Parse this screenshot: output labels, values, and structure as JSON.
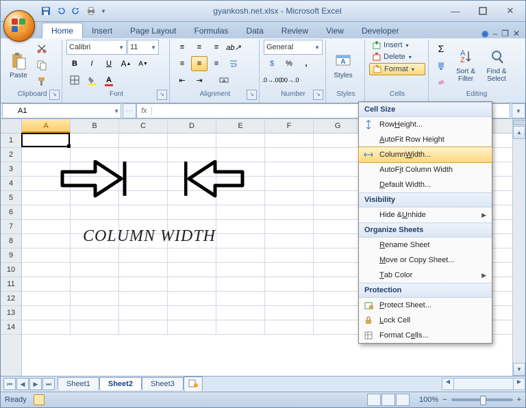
{
  "title": "gyankosh.net.xlsx - Microsoft Excel",
  "tabs": [
    "Home",
    "Insert",
    "Page Layout",
    "Formulas",
    "Data",
    "Review",
    "View",
    "Developer"
  ],
  "activeTab": 0,
  "ribbon": {
    "clipboard": {
      "label": "Clipboard",
      "paste": "Paste"
    },
    "font": {
      "label": "Font",
      "face": "Calibri",
      "size": "11"
    },
    "alignment": {
      "label": "Alignment"
    },
    "number": {
      "label": "Number",
      "format": "General"
    },
    "styles": {
      "label": "Styles",
      "btn": "Styles"
    },
    "cells": {
      "label": "Cells",
      "insert": "Insert",
      "delete": "Delete",
      "format": "Format"
    },
    "editing": {
      "label": "Editing",
      "sortfilter": "Sort & Filter",
      "findselect": "Find & Select"
    }
  },
  "namebox": "A1",
  "columns": [
    "A",
    "B",
    "C",
    "D",
    "E",
    "F",
    "G"
  ],
  "rows": [
    "1",
    "2",
    "3",
    "4",
    "5",
    "6",
    "7",
    "8",
    "9",
    "10",
    "11",
    "12",
    "13",
    "14"
  ],
  "sheetTabs": [
    "Sheet1",
    "Sheet2",
    "Sheet3"
  ],
  "activeSheet": 1,
  "overlayText": "COLUMN WIDTH",
  "status": "Ready",
  "zoom": "100%",
  "formatMenu": {
    "sections": {
      "cellSize": "Cell Size",
      "visibility": "Visibility",
      "organize": "Organize Sheets",
      "protection": "Protection"
    },
    "items": {
      "rowHeight": "Row Height...",
      "autofitRow": "AutoFit Row Height",
      "colWidth": "Column Width...",
      "autofitCol": "AutoFit Column Width",
      "defWidth": "Default Width...",
      "hideUnhide": "Hide & Unhide",
      "rename": "Rename Sheet",
      "moveCopy": "Move or Copy Sheet...",
      "tabColor": "Tab Color",
      "protectSheet": "Protect Sheet...",
      "lockCell": "Lock Cell",
      "formatCells": "Format Cells..."
    }
  }
}
